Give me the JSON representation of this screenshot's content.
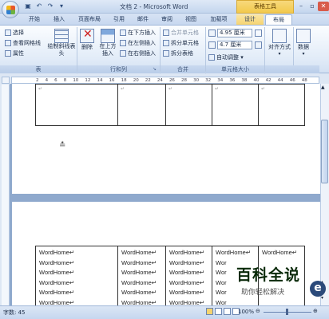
{
  "titlebar": {
    "title": "文档 2 - Microsoft Word",
    "context_tab": "表格工具"
  },
  "tabs": [
    "开始",
    "插入",
    "页面布局",
    "引用",
    "邮件",
    "审阅",
    "视图",
    "加载项",
    "设计",
    "布局"
  ],
  "ribbon": {
    "table_group": {
      "items": [
        "选择",
        "查看网格线",
        "属性"
      ],
      "big": "绘制斜线表头",
      "label": "表"
    },
    "rows_cols_group": {
      "delete": "删除",
      "insert_above": "在上方插入",
      "items": [
        "在下方插入",
        "在左侧插入",
        "在右侧插入"
      ],
      "label": "行和列"
    },
    "merge_group": {
      "items": [
        "合并单元格",
        "拆分单元格",
        "拆分表格"
      ],
      "label": "合并"
    },
    "cell_size_group": {
      "height": "4.95 厘米",
      "width": "4.7 厘米",
      "autofit": "自动调整",
      "label": "单元格大小"
    },
    "align": "对齐方式",
    "data": "数据"
  },
  "ruler_numbers": [
    "2",
    "4",
    "6",
    "8",
    "10",
    "12",
    "14",
    "16",
    "18",
    "20",
    "22",
    "24",
    "26",
    "28",
    "30",
    "32",
    "34",
    "36",
    "38",
    "40",
    "42",
    "44",
    "46",
    "48"
  ],
  "table2_text": "WordHome",
  "table2_partial": "Wor",
  "status": {
    "words": "字数: 45",
    "zoom": "100%"
  },
  "watermark": {
    "title": "百科全说",
    "subtitle": "助你轻松解决"
  }
}
